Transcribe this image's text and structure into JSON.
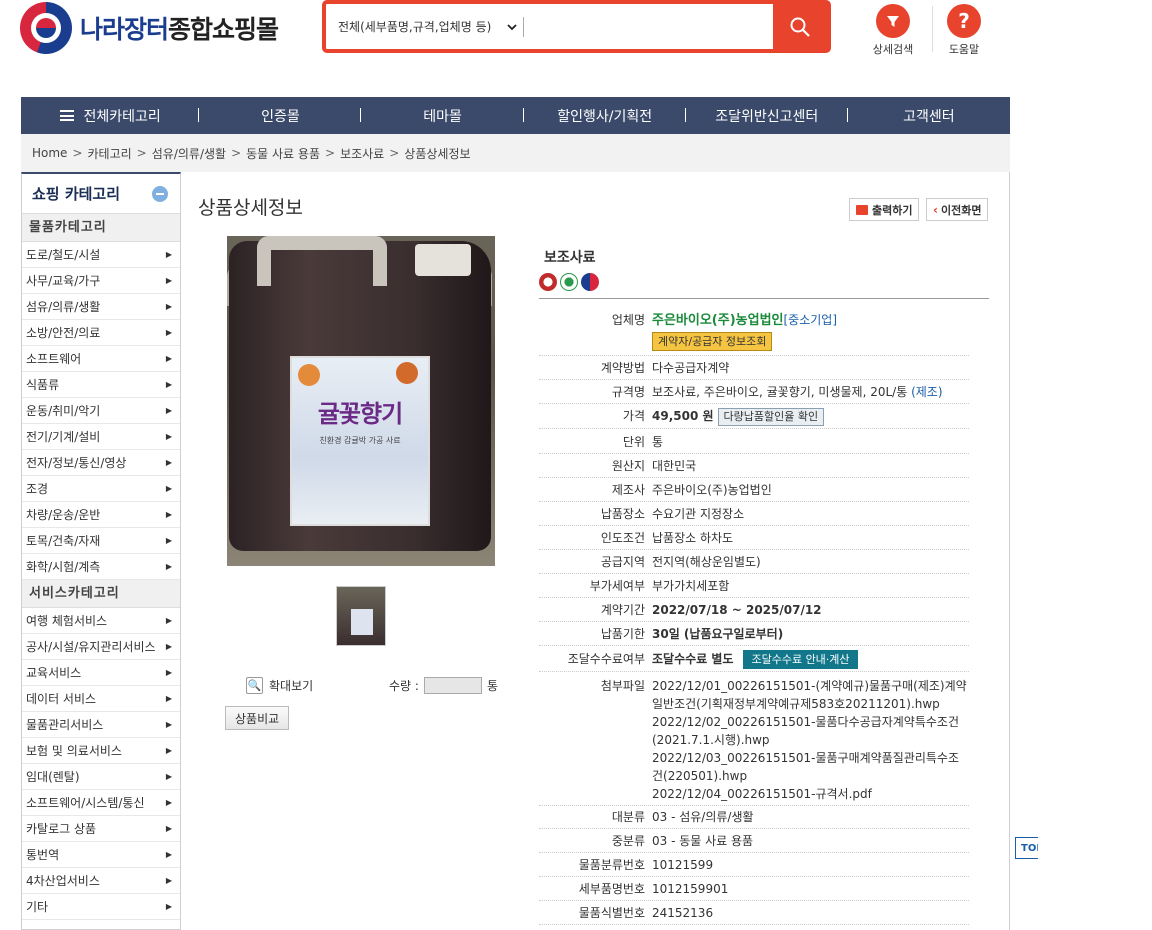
{
  "header": {
    "logo_part1": "나라장터",
    "logo_part2": "종합쇼핑몰",
    "search_select": "전체(세부품명,규격,업체명 등)",
    "search_value": "",
    "detail_search": "상세검색",
    "help": "도움말",
    "help_glyph": "?"
  },
  "nav": {
    "items": [
      "전체카테고리",
      "인증몰",
      "테마몰",
      "할인행사/기획전",
      "조달위반신고센터",
      "고객센터"
    ]
  },
  "breadcrumb": [
    "Home",
    "카테고리",
    "섬유/의류/생활",
    "동물 사료 용품",
    "보조사료",
    "상품상세정보"
  ],
  "sidebar": {
    "title": "쇼핑 카테고리",
    "goods_section": "물품카테고리",
    "goods_items": [
      "도로/철도/시설",
      "사무/교육/가구",
      "섬유/의류/생활",
      "소방/안전/의료",
      "소프트웨어",
      "식품류",
      "운동/취미/악기",
      "전기/기계/설비",
      "전자/정보/통신/영상",
      "조경",
      "차량/운송/운반",
      "토목/건축/자재",
      "화학/시험/계측"
    ],
    "service_section": "서비스카테고리",
    "service_items": [
      "여행 체험서비스",
      "공사/시설/유지관리서비스",
      "교육서비스",
      "데이터 서비스",
      "물품관리서비스",
      "보험 및 의료서비스",
      "임대(렌탈)",
      "소프트웨어/시스템/통신",
      "카탈로그 상품",
      "통번역",
      "4차산업서비스",
      "기타"
    ]
  },
  "page": {
    "title": "상품상세정보",
    "print": "출력하기",
    "back": "이전화면",
    "zoom": "확대보기",
    "qty_label": "수량 :",
    "qty_value": "",
    "unit": "통",
    "compare": "상품비교",
    "label_title": "귤꽃향기",
    "label_sub": "친환경 감귤박 가공 사료"
  },
  "product": {
    "name": "보조사료",
    "company_label": "업체명",
    "company": "주은바이오(주)농업법인",
    "company_tag": "[중소기업]",
    "company_btn": "계약자/공급자 정보조회",
    "contract_method_label": "계약방법",
    "contract_method": "다수공급자계약",
    "spec_label": "규격명",
    "spec": "보조사료, 주은바이오, 귤꽃향기, 미생물제, 20L/통",
    "spec_tag": "(제조)",
    "price_label": "가격",
    "price": "49,500 원",
    "price_btn": "다량납품할인율 확인",
    "unit_label": "단위",
    "unit": "통",
    "origin_label": "원산지",
    "origin": "대한민국",
    "maker_label": "제조사",
    "maker": "주은바이오(주)농업법인",
    "delivery_place_label": "납품장소",
    "delivery_place": "수요기관 지정장소",
    "delivery_cond_label": "인도조건",
    "delivery_cond": "납품장소 하차도",
    "supply_area_label": "공급지역",
    "supply_area": "전지역(해상운임별도)",
    "vat_label": "부가세여부",
    "vat": "부가가치세포함",
    "period_label": "계약기간",
    "period": "2022/07/18 ~ 2025/07/12",
    "deadline_label": "납품기한",
    "deadline": "30일 (납품요구일로부터)",
    "fee_label": "조달수수료여부",
    "fee": "조달수수료 별도",
    "fee_btn": "조달수수료 안내·계산",
    "attach_label": "첨부파일",
    "attachments": [
      "2022/12/01_00226151501-(계약예규)물품구매(제조)계약일반조건(기획재정부계약예규제583호20211201).hwp",
      "2022/12/02_00226151501-물품다수공급자계약특수조건(2021.7.1.시행).hwp",
      "2022/12/03_00226151501-물품구매계약품질관리특수조건(220501).hwp",
      "2022/12/04_00226151501-규격서.pdf"
    ],
    "major_label": "대분류",
    "major": "03 - 섬유/의류/생활",
    "middle_label": "중분류",
    "middle": "03 - 동물 사료 용품",
    "class_no_label": "물품분류번호",
    "class_no": "10121599",
    "detail_no_label": "세부품명번호",
    "detail_no": "1012159901",
    "id_no_label": "물품식별번호",
    "id_no": "24152136"
  },
  "to_top": "TOP",
  "colors": {
    "accent": "#e8432d",
    "nav": "#3b4a6b",
    "company": "#1a8a3a",
    "link": "#1a5fa8"
  }
}
